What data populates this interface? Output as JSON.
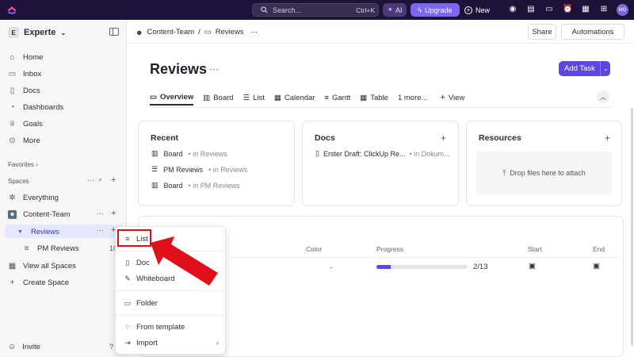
{
  "topbar": {
    "search_label": "Search...",
    "search_shortcut": "Ctrl+K",
    "ai_label": "AI",
    "upgrade_label": "Upgrade",
    "new_label": "New",
    "avatar_initials": "MG"
  },
  "sidebar": {
    "workspace_initial": "E",
    "workspace_name": "Experte",
    "nav": [
      {
        "label": "Home",
        "icon": "home-icon"
      },
      {
        "label": "Inbox",
        "icon": "inbox-icon"
      },
      {
        "label": "Docs",
        "icon": "docs-icon"
      },
      {
        "label": "Dashboards",
        "icon": "dashboards-icon"
      },
      {
        "label": "Goals",
        "icon": "goals-icon"
      },
      {
        "label": "More",
        "icon": "more-icon"
      }
    ],
    "favorites_label": "Favorites",
    "spaces_label": "Spaces",
    "everything_label": "Everything",
    "space_name": "Content-Team",
    "folder_name": "Reviews",
    "list_name": "PM Reviews",
    "list_count": "10",
    "view_all_spaces": "View all Spaces",
    "create_space": "Create Space",
    "invite_label": "Invite"
  },
  "header": {
    "crumb_space": "Content-Team",
    "crumb_sep": "/",
    "crumb_folder": "Reviews",
    "share_label": "Share",
    "automations_label": "Automations"
  },
  "page": {
    "title": "Reviews",
    "add_task_label": "Add Task",
    "tabs": [
      {
        "label": "Overview",
        "icon": "overview-icon"
      },
      {
        "label": "Board",
        "icon": "board-icon"
      },
      {
        "label": "List",
        "icon": "list-icon"
      },
      {
        "label": "Calendar",
        "icon": "calendar-icon"
      },
      {
        "label": "Gantt",
        "icon": "gantt-icon"
      },
      {
        "label": "Table",
        "icon": "table-icon"
      },
      {
        "label": "1 more...",
        "icon": ""
      },
      {
        "label": "View",
        "icon": "plus-icon"
      }
    ]
  },
  "cards": {
    "recent": {
      "title": "Recent",
      "items": [
        {
          "name": "Board",
          "location": "• in Reviews"
        },
        {
          "name": "PM Reviews",
          "location": "• in Reviews"
        },
        {
          "name": "Board",
          "location": "• in PM Reviews"
        }
      ]
    },
    "docs": {
      "title": "Docs",
      "items": [
        {
          "name": "Erster Draft: ClickUp Re...",
          "location": "• in Dokum..."
        }
      ]
    },
    "resources": {
      "title": "Resources",
      "drop_label": "Drop files here to attach"
    }
  },
  "lists_table": {
    "columns": [
      "Color",
      "Progress",
      "Start",
      "End"
    ],
    "rows": [
      {
        "color": "-",
        "progress_text": "2/13",
        "progress_fraction": 0.154
      }
    ]
  },
  "create_menu": {
    "items": [
      {
        "label": "List",
        "icon": "list-icon"
      },
      {
        "label": "Doc",
        "icon": "doc-icon"
      },
      {
        "label": "Whiteboard",
        "icon": "whiteboard-icon"
      },
      {
        "label": "Folder",
        "icon": "folder-icon"
      },
      {
        "label": "From template",
        "icon": "template-icon"
      },
      {
        "label": "Import",
        "icon": "import-icon"
      }
    ]
  },
  "colors": {
    "topbar_bg": "#1f1238",
    "accent": "#5b48e0",
    "annotation_red": "#e0101a"
  }
}
